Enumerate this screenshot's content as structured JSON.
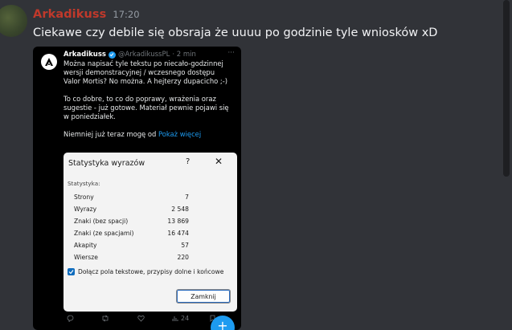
{
  "message": {
    "author": "Arkadikuss",
    "time": "17:20",
    "text": "Ciekawe czy debile się obsraja że uuuu po godzinie tyle wniosków xD"
  },
  "tweet": {
    "name": "Arkadikuss",
    "handle": "@ArkadikussPL",
    "age": "· 2 min",
    "more": "···",
    "p1": [
      "Można napisać  tyle tekstu po niecało-godzinnej",
      "wersji demonstracyjnej / wczesnego dostępu",
      "Valor Mortis? No można. A hejterzy dupacicho ;-)"
    ],
    "p2": [
      "To co dobre, to co do poprawy, wrażenia oraz",
      "sugestie - już gotowe. Materiał pewnie pojawi się",
      "w poniedziałek."
    ],
    "p3_prefix": "Niemniej już teraz mogę od",
    "p3_link": "Pokaż więcej",
    "views": "24"
  },
  "dialog": {
    "title": "Statystyka wyrazów",
    "help": "?",
    "close": "✕",
    "section": "Statystyka:",
    "stats": [
      {
        "label": "Strony",
        "value": "7"
      },
      {
        "label": "Wyrazy",
        "value": "2 548"
      },
      {
        "label": "Znaki (bez spacji)",
        "value": "13 869"
      },
      {
        "label": "Znaki (ze spacjami)",
        "value": "16 474"
      },
      {
        "label": "Akapity",
        "value": "57"
      },
      {
        "label": "Wiersze",
        "value": "220"
      }
    ],
    "checkbox_label": "Dołącz pola tekstowe, przypisy dolne i końcowe",
    "checkbox_checked": true,
    "button": "Zamknij"
  }
}
